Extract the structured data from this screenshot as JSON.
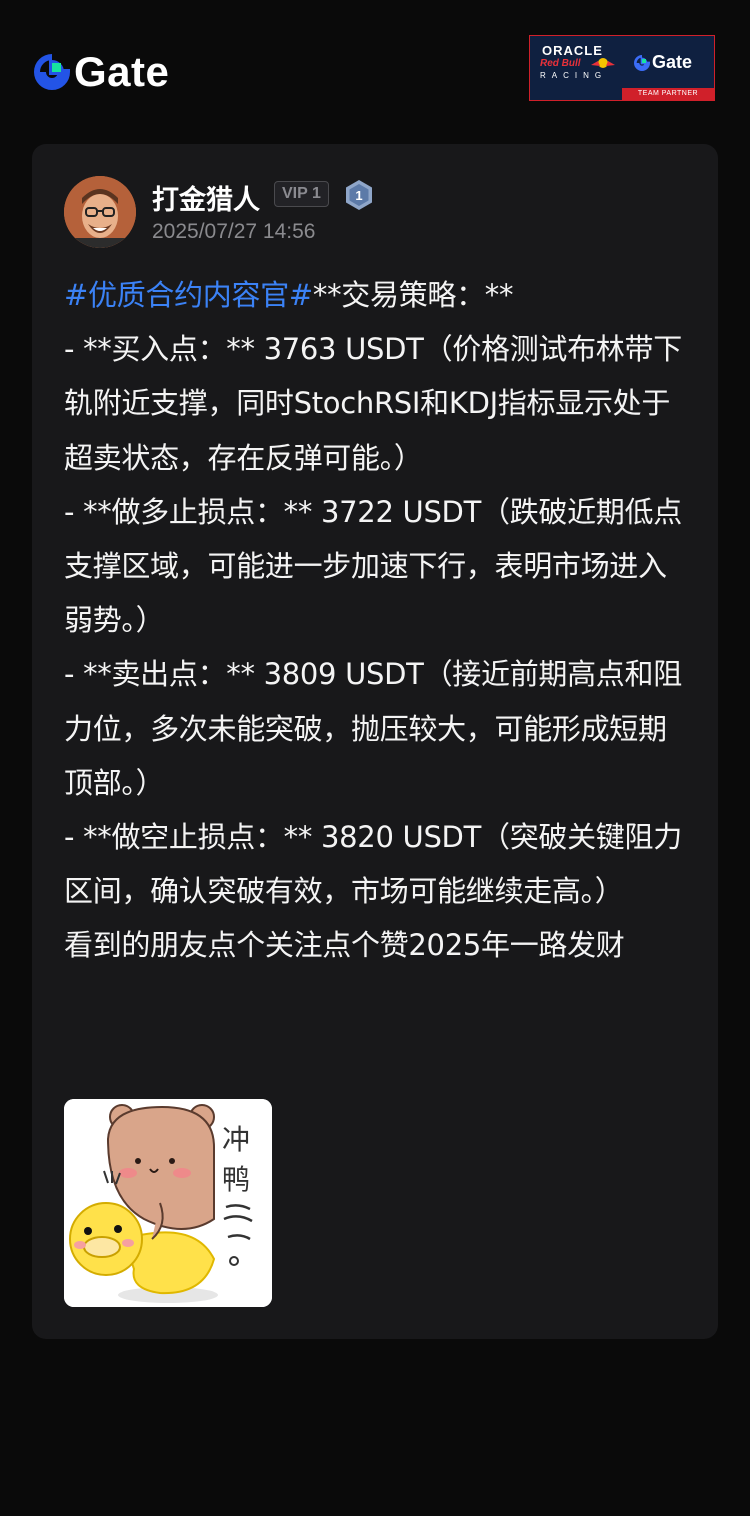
{
  "header": {
    "logo_text": "Gate",
    "partner": {
      "oracle": "ORACLE",
      "redbull": "Red Bull",
      "racing": "RACING",
      "gate": "Gate",
      "ribbon": "TEAM PARTNER"
    }
  },
  "post": {
    "author": "打金猎人",
    "vip_label": "VIP 1",
    "level": "1",
    "timestamp": "2025/07/27 14:56",
    "hashtag": "#优质合约内容官#",
    "lines": [
      "**交易策略：**",
      "- **买入点：** 3763 USDT（价格测试布林带下轨附近支撑，同时StochRSI和KDJ指标显示处于超卖状态，存在反弹可能。）",
      "- **做多止损点：** 3722 USDT（跌破近期低点支撑区域，可能进一步加速下行，表明市场进入弱势。）",
      "- **卖出点：** 3809 USDT（接近前期高点和阻力位，多次未能突破，抛压较大，可能形成短期顶部。）",
      "- **做空止损点：** 3820 USDT（突破关键阻力区间，确认突破有效，市场可能继续走高。）",
      "看到的朋友点个关注点个赞2025年一路发财"
    ],
    "sticker_text": "冲鸭~~。"
  },
  "colors": {
    "background": "#0a0a0a",
    "card": "#18181a",
    "hashtag": "#3b82f6",
    "brand_blue": "#2354e6",
    "brand_green": "#17e5a0"
  }
}
